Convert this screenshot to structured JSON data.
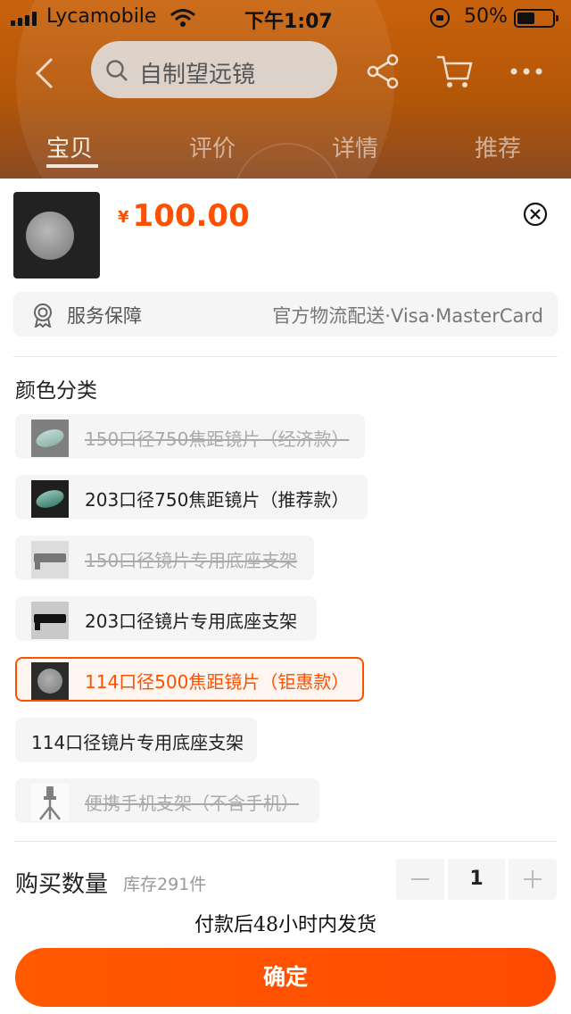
{
  "status_bar": {
    "carrier": "Lycamobile",
    "time": "下午1:07",
    "battery": "50%"
  },
  "header": {
    "search_text": "自制望远镜",
    "icons": [
      "back-icon",
      "search-icon",
      "share-icon",
      "cart-icon",
      "more-icon"
    ]
  },
  "tabs": [
    {
      "label": "宝贝",
      "active": true
    },
    {
      "label": "评价",
      "active": false
    },
    {
      "label": "详情",
      "active": false
    },
    {
      "label": "推荐",
      "active": false
    }
  ],
  "product": {
    "currency": "¥",
    "price": "100.00"
  },
  "service": {
    "label": "服务保障",
    "info": "官方物流配送·Visa·MasterCard"
  },
  "options": {
    "title": "颜色分类",
    "items": [
      {
        "label": "150口径750焦距镜片（经济款）",
        "state": "disabled",
        "thumb": "lens"
      },
      {
        "label": "203口径750焦距镜片（推荐款）",
        "state": "available",
        "thumb": "lens"
      },
      {
        "label": "150口径镜片专用底座支架",
        "state": "disabled",
        "thumb": "mount"
      },
      {
        "label": "203口径镜片专用底座支架",
        "state": "available",
        "thumb": "mount"
      },
      {
        "label": "114口径500焦距镜片（钜惠款）",
        "state": "selected",
        "thumb": "round-lens"
      },
      {
        "label": "114口径镜片专用底座支架",
        "state": "available",
        "thumb": "none"
      },
      {
        "label": "便携手机支架（不含手机）",
        "state": "disabled",
        "thumb": "tripod"
      }
    ]
  },
  "quantity": {
    "label": "购买数量",
    "stock": "库存291件",
    "value": "1"
  },
  "shipping_note": "付款后48小时内发货",
  "confirm_label": "确定",
  "colors": {
    "accent": "#ff5000",
    "header_bg": "#b35608"
  }
}
